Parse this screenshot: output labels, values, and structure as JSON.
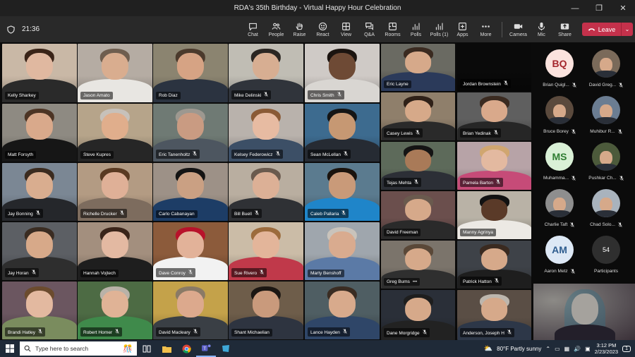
{
  "window": {
    "title": "RDA's 35th Birthday - Virtual Happy Hour Celebration",
    "minimize": "—",
    "maximize": "❐",
    "close": "✕"
  },
  "toolbar": {
    "timer": "21:36",
    "buttons": [
      {
        "label": "Chat",
        "icon": "chat-icon"
      },
      {
        "label": "People",
        "icon": "people-icon"
      },
      {
        "label": "Raise",
        "icon": "hand-icon"
      },
      {
        "label": "React",
        "icon": "smile-icon"
      },
      {
        "label": "View",
        "icon": "grid-icon"
      },
      {
        "label": "Q&A",
        "icon": "qa-icon"
      },
      {
        "label": "Rooms",
        "icon": "rooms-icon"
      },
      {
        "label": "Polls",
        "icon": "polls-icon"
      },
      {
        "label": "Polls (1)",
        "icon": "polls-icon"
      },
      {
        "label": "Apps",
        "icon": "apps-icon"
      },
      {
        "label": "More",
        "icon": "more-icon"
      }
    ],
    "camera": "Camera",
    "mic": "Mic",
    "share": "Share",
    "leave": "Leave"
  },
  "grid": [
    {
      "name": "Kelly Sharkey",
      "muted": false,
      "bg": "#c9b8a6",
      "skin": "#e0b8a0",
      "shirt": "#2a2a2a",
      "hair": "#3a2418"
    },
    {
      "name": "Jason Amato",
      "muted": false,
      "bg": "#b5aca3",
      "skin": "#d9ad8f",
      "shirt": "#e8e6e2",
      "hair": "#6f5e4f"
    },
    {
      "name": "Rob Diaz",
      "muted": false,
      "bg": "#8b8470",
      "skin": "#d6a384",
      "shirt": "#2b3340",
      "hair": "#4b3a2c"
    },
    {
      "name": "Mike Delinski",
      "muted": true,
      "bg": "#c0bdb4",
      "skin": "#d7ae92",
      "shirt": "#30343b",
      "hair": "#2b2622"
    },
    {
      "name": "Chris Smith",
      "muted": true,
      "bg": "#cfcac6",
      "skin": "#6e4a35",
      "shirt": "#d9d6d2",
      "hair": "#1b1410"
    },
    {
      "name": "Matt Forsyth",
      "muted": false,
      "bg": "#8e8a82",
      "skin": "#d9a98b",
      "shirt": "#161616",
      "hair": "#4c3424"
    },
    {
      "name": "Steve Kupres",
      "muted": false,
      "bg": "#b6a48a",
      "skin": "#e0ae8c",
      "shirt": "#262626",
      "hair": "#c7c1ba"
    },
    {
      "name": "Eric Tanenholtz",
      "muted": true,
      "bg": "#6f7a74",
      "skin": "#c99b82",
      "shirt": "#4d5660",
      "hair": "#9d9890"
    },
    {
      "name": "Kelsey Federowicz",
      "muted": true,
      "bg": "#b9b2ac",
      "skin": "#e7bba2",
      "shirt": "#3c4f66",
      "hair": "#8a5a36"
    },
    {
      "name": "Sean McLellan",
      "muted": true,
      "bg": "#3d6b8f",
      "skin": "#c69873",
      "shirt": "#262b33",
      "hair": "#151515"
    },
    {
      "name": "Jay Bonning",
      "muted": true,
      "bg": "#7b8794",
      "skin": "#d9ad8f",
      "shirt": "#25272b",
      "hair": "#3b2b1f"
    },
    {
      "name": "Richelle Drucker",
      "muted": true,
      "bg": "#b39b83",
      "skin": "#dfb097",
      "shirt": "#7d6c5e",
      "hair": "#5a3a22"
    },
    {
      "name": "Carlo Cabanayan",
      "muted": false,
      "bg": "#9d9187",
      "skin": "#caa083",
      "shirt": "#1d3d66",
      "hair": "#141414"
    },
    {
      "name": "Bill Buell",
      "muted": true,
      "bg": "#b9aea0",
      "skin": "#dcb096",
      "shirt": "#2f3135",
      "hair": "#6a5a4e"
    },
    {
      "name": "Caleb Pallaria",
      "muted": true,
      "bg": "#5b7b8f",
      "skin": "#c99a79",
      "shirt": "#1f85c9",
      "hair": "#1a130d"
    },
    {
      "name": "Jay Horan",
      "muted": true,
      "bg": "#5c5f64",
      "skin": "#d7a989",
      "shirt": "#2e2e2e",
      "hair": "#3a2c22"
    },
    {
      "name": "Hannah Vojtech",
      "muted": false,
      "bg": "#a38f7e",
      "skin": "#e3b9a2",
      "shirt": "#1e1e1e",
      "hair": "#3a2419"
    },
    {
      "name": "Dave Conroy",
      "muted": true,
      "bg": "#8c5b3b",
      "skin": "#e2b299",
      "shirt": "#f2f2f2",
      "hair": "#b8122a"
    },
    {
      "name": "Sue Rivero",
      "muted": true,
      "bg": "#cbbca7",
      "skin": "#e3b59a",
      "shirt": "#c0394a",
      "hair": "#9c6b3c"
    },
    {
      "name": "Marty Benshoff",
      "muted": false,
      "bg": "#9fa6ad",
      "skin": "#d9ab8f",
      "shirt": "#5b7aa6",
      "hair": "#c9c3bb"
    },
    {
      "name": "Brandi Hatley",
      "muted": true,
      "bg": "#6b5660",
      "skin": "#e3b9a0",
      "shirt": "#7a8c5e",
      "hair": "#6b4b2e"
    },
    {
      "name": "Robert Horner",
      "muted": true,
      "bg": "#4d6b44",
      "skin": "#e0b396",
      "shirt": "#3f8a4b",
      "hair": "#b9b2a8"
    },
    {
      "name": "David Macleary",
      "muted": true,
      "bg": "#c4a24a",
      "skin": "#dca98d",
      "shirt": "#3a3f45",
      "hair": "#8a7a66"
    },
    {
      "name": "Shant Michaelian",
      "muted": false,
      "bg": "#6e5d4a",
      "skin": "#c99a7c",
      "shirt": "#2e3440",
      "hair": "#1b1612"
    },
    {
      "name": "Lance Hayden",
      "muted": true,
      "bg": "#4f5e63",
      "skin": "#d8aa8c",
      "shirt": "#2f4668",
      "hair": "#3a2c22"
    }
  ],
  "grid2": [
    {
      "name": "Eric Layne",
      "muted": false,
      "bg": "#6a6a62",
      "skin": "#d6a98a",
      "shirt": "#2b3a5a",
      "hair": "#3a2a20"
    },
    {
      "name": "Jordan Brownstein",
      "muted": true,
      "bg": "#0a0a0a",
      "skin": "",
      "shirt": "",
      "hair": ""
    },
    {
      "name": "Casey Lewis",
      "muted": true,
      "bg": "#8f7f6b",
      "skin": "#d6a989",
      "shirt": "#2a2a2a",
      "hair": "#2f2118"
    },
    {
      "name": "Brian Yedinak",
      "muted": true,
      "bg": "#5f5f5f",
      "skin": "#d9a98b",
      "shirt": "#262626",
      "hair": "#3a2a20"
    },
    {
      "name": "Tejas Mehta",
      "muted": true,
      "bg": "#5d6a5a",
      "skin": "#a97a58",
      "shirt": "#2c2f36",
      "hair": "#141414"
    },
    {
      "name": "Pamela Barton",
      "muted": true,
      "bg": "#b7a3a7",
      "skin": "#e3b9a0",
      "shirt": "#c64b78",
      "hair": "#d0a670"
    },
    {
      "name": "David Freeman",
      "muted": false,
      "bg": "#6b4f4d",
      "skin": "#d6a98a",
      "shirt": "#2a2a2a",
      "hair": "#6a5a4e"
    },
    {
      "name": "Manny Agrinya",
      "muted": false,
      "bg": "#b9b2a6",
      "skin": "#5a3a28",
      "shirt": "#ece9e4",
      "hair": "#121212"
    },
    {
      "name": "Greg Bums",
      "muted": false,
      "more": true,
      "bg": "#7b746b",
      "skin": "#d6a98a",
      "shirt": "#2f2f2f",
      "hair": "#5a4838"
    },
    {
      "name": "Patrick Hatton",
      "muted": true,
      "bg": "#3e4248",
      "skin": "#d6a98a",
      "shirt": "#1e1e1e",
      "hair": "#3a2a20"
    },
    {
      "name": "Dane Morgridge",
      "muted": true,
      "bg": "#2a2f38",
      "skin": "#d6a98a",
      "shirt": "#222222",
      "hair": "#1e1e1e"
    },
    {
      "name": "Anderson, Joseph H",
      "muted": true,
      "bg": "#5a4e45",
      "skin": "#d6a98a",
      "shirt": "#2d3748",
      "hair": "#bdb6ad"
    }
  ],
  "rail": [
    {
      "name": "Brian Quigl...",
      "initials": "BQ",
      "avbg": "#fbe3de",
      "avfg": "#a4262c",
      "photo": false
    },
    {
      "name": "David Greg...",
      "initials": "",
      "avbg": "#7a6a5a",
      "photo": true
    },
    {
      "name": "Bruce Borey",
      "initials": "",
      "avbg": "#5b4a3d",
      "photo": true
    },
    {
      "name": "Muhibur R...",
      "initials": "",
      "avbg": "#6b7d92",
      "photo": true
    },
    {
      "name": "Muhamma...",
      "initials": "MS",
      "avbg": "#d9f0d6",
      "avfg": "#2f7d32",
      "photo": false
    },
    {
      "name": "Pushkar Ch...",
      "initials": "",
      "avbg": "#4c5a3b",
      "photo": true
    },
    {
      "name": "Charlie Taft",
      "initials": "",
      "avbg": "#8e8e8e",
      "photo": true
    },
    {
      "name": "Chad Solo...",
      "initials": "",
      "avbg": "#a9b3bd",
      "photo": true
    },
    {
      "name": "Aaron Metz",
      "initials": "AM",
      "avbg": "#dde8f5",
      "avfg": "#2f5d8f",
      "photo": false
    }
  ],
  "participants": {
    "count": "54",
    "label": "Participants"
  },
  "taskbar": {
    "search_placeholder": "Type here to search",
    "weather": "80°F  Partly sunny",
    "time": "3:12 PM",
    "date": "2/23/2023",
    "notif": "1"
  }
}
